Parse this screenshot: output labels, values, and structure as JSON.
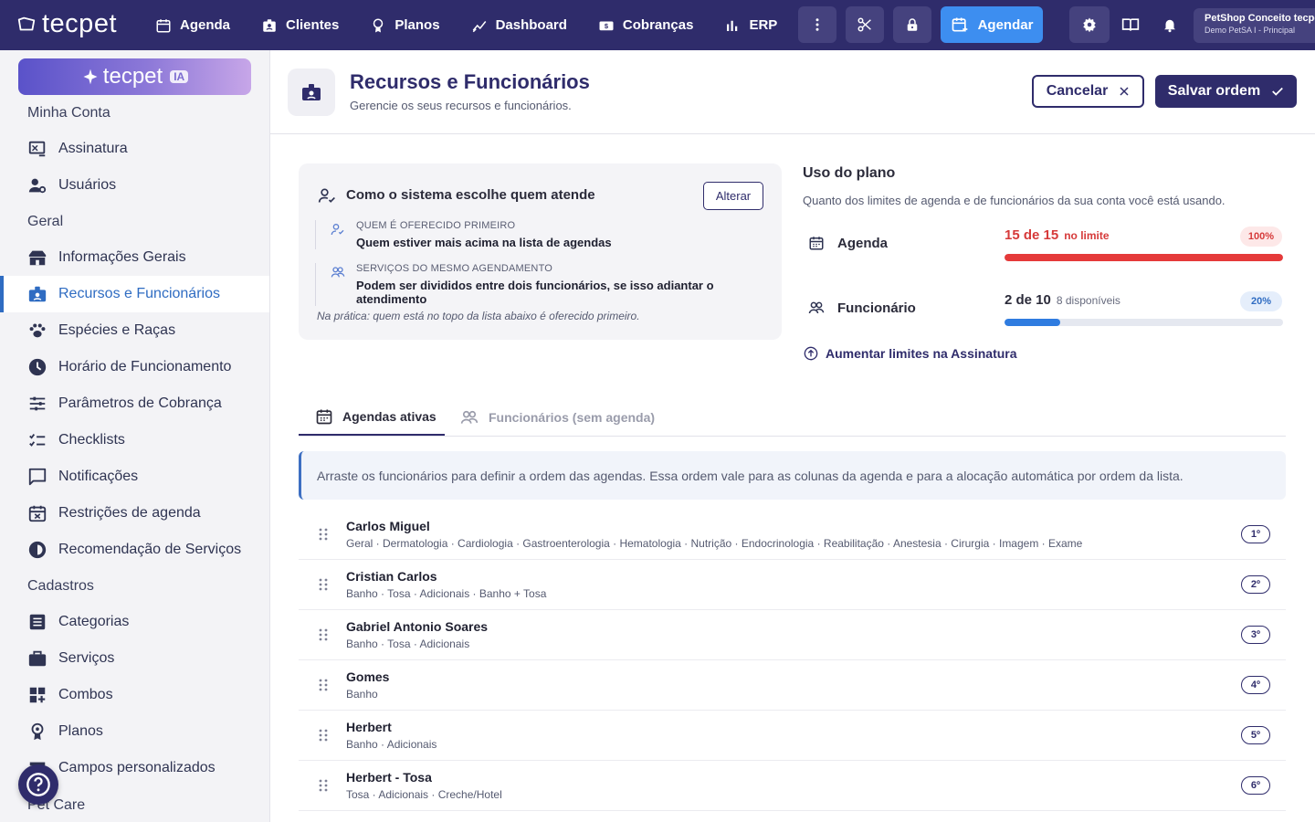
{
  "topbar": {
    "logo": "tecpet",
    "nav": [
      {
        "label": "Agenda",
        "icon": "calendar-icon"
      },
      {
        "label": "Clientes",
        "icon": "contacts-icon"
      },
      {
        "label": "Planos",
        "icon": "medal-icon"
      },
      {
        "label": "Dashboard",
        "icon": "chart-line-icon"
      },
      {
        "label": "Cobranças",
        "icon": "money-icon"
      },
      {
        "label": "ERP",
        "icon": "bar-chart-icon"
      }
    ],
    "agendar_label": "Agendar",
    "account_name": "PetShop Conceito tecpet",
    "account_sub": "Demo PetSA I - Principal"
  },
  "sidebar": {
    "ia_label": "tecpet",
    "ia_badge": "IA",
    "sections": {
      "minha_conta": "Minha Conta",
      "geral": "Geral",
      "cadastros": "Cadastros",
      "pet_care": "Pet Care"
    },
    "items": [
      {
        "label": "Assinatura"
      },
      {
        "label": "Usuários"
      },
      {
        "label": "Informações Gerais"
      },
      {
        "label": "Recursos e Funcionários"
      },
      {
        "label": "Espécies e Raças"
      },
      {
        "label": "Horário de Funcionamento"
      },
      {
        "label": "Parâmetros de Cobrança"
      },
      {
        "label": "Checklists"
      },
      {
        "label": "Notificações"
      },
      {
        "label": "Restrições de agenda"
      },
      {
        "label": "Recomendação de Serviços"
      },
      {
        "label": "Categorias"
      },
      {
        "label": "Serviços"
      },
      {
        "label": "Combos"
      },
      {
        "label": "Planos"
      },
      {
        "label": "Campos personalizados"
      }
    ]
  },
  "header": {
    "title": "Recursos e Funcionários",
    "subtitle": "Gerencie os seus recursos e funcionários.",
    "cancel_label": "Cancelar",
    "save_label": "Salvar ordem"
  },
  "selection_card": {
    "title": "Como o sistema escolhe quem atende",
    "change_label": "Alterar",
    "rules": [
      {
        "label": "QUEM É OFERECIDO PRIMEIRO",
        "value": "Quem estiver mais acima na lista de agendas"
      },
      {
        "label": "SERVIÇOS DO MESMO AGENDAMENTO",
        "value": "Podem ser divididos entre dois funcionários, se isso adiantar o atendimento"
      }
    ],
    "note": "Na prática: quem está no topo da lista abaixo é oferecido primeiro."
  },
  "plan_usage": {
    "title": "Uso do plano",
    "subtitle": "Quanto dos limites de agenda e de funcionários da sua conta você está usando.",
    "agenda": {
      "label": "Agenda",
      "count": "15 de 15",
      "note": "no limite",
      "pct_label": "100%",
      "fraction": 1.0
    },
    "funcionario": {
      "label": "Funcionário",
      "count": "2 de 10",
      "note": "8 disponíveis",
      "pct_label": "20%",
      "fraction": 0.2
    },
    "more_limits_label": "Aumentar limites na Assinatura",
    "colors": {
      "danger": "#e53a3a",
      "primary": "#2f7ce0"
    }
  },
  "tabs": [
    {
      "label": "Agendas ativas"
    },
    {
      "label": "Funcionários (sem agenda)"
    }
  ],
  "info_text": "Arraste os funcionários para definir a ordem das agendas. Essa ordem vale para as colunas da agenda e para a alocação automática por ordem da lista.",
  "agendas": [
    {
      "name": "Carlos Miguel",
      "services": "Geral · Dermatologia · Cardiologia · Gastroenterologia · Hematologia · Nutrição · Endocrinologia · Reabilitação · Anestesia · Cirurgia · Imagem · Exame",
      "order": "1º"
    },
    {
      "name": "Cristian Carlos",
      "services": "Banho · Tosa · Adicionais · Banho + Tosa",
      "order": "2º"
    },
    {
      "name": "Gabriel Antonio Soares",
      "services": "Banho · Tosa · Adicionais",
      "order": "3º"
    },
    {
      "name": "Gomes",
      "services": "Banho",
      "order": "4º"
    },
    {
      "name": "Herbert",
      "services": "Banho · Adicionais",
      "order": "5º"
    },
    {
      "name": "Herbert - Tosa",
      "services": "Tosa · Adicionais · Creche/Hotel",
      "order": "6º"
    }
  ]
}
